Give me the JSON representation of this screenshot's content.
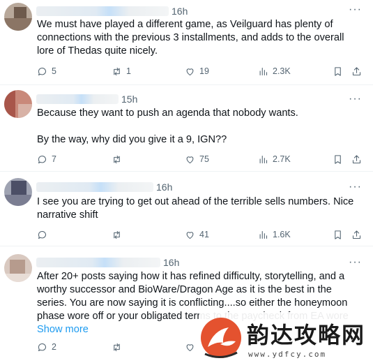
{
  "tweets": [
    {
      "time": "16h",
      "text": [
        "We must have played a different game, as Veilguard has plenty of connections with the previous 3 installments, and adds to the overall lore of Thedas quite nicely."
      ],
      "show_more": "",
      "replies": "5",
      "reposts": "1",
      "likes": "19",
      "views": "2.3K"
    },
    {
      "time": "15h",
      "text": [
        "Because they want to push an agenda that nobody wants.",
        "",
        "By the way, why did you give it a 9, IGN??"
      ],
      "show_more": "",
      "replies": "7",
      "reposts": "",
      "likes": "75",
      "views": "2.7K"
    },
    {
      "time": "16h",
      "text": [
        "I see you are trying to get out ahead of the terrible sells numbers. Nice narrative shift"
      ],
      "show_more": "",
      "replies": "",
      "reposts": "",
      "likes": "41",
      "views": "1.6K"
    },
    {
      "time": "16h",
      "text": [
        "After 20+ posts saying how it has refined difficulty, storytelling, and a worthy successor and BioWare/Dragon Age as it is the best in the series. You are now saying it is conflicting....so either the honeymoon phase wore off or your obligated terms to the paycheck from EA wore"
      ],
      "show_more": "Show more",
      "replies": "2",
      "reposts": "",
      "likes": "",
      "views": ""
    }
  ],
  "icons": {
    "more": "more-horizontal-icon",
    "reply": "reply-bubble-icon",
    "repost": "repost-arrows-icon",
    "like": "heart-icon",
    "views": "analytics-bars-icon",
    "bookmark": "bookmark-icon",
    "share": "share-upload-icon"
  },
  "colors": {
    "text": "#0f1419",
    "secondary": "#536471",
    "link": "#1d9bf0",
    "divider": "#eff3f4"
  },
  "watermark": {
    "title": "韵达攻略网",
    "url": "www.ydfcy.com"
  }
}
